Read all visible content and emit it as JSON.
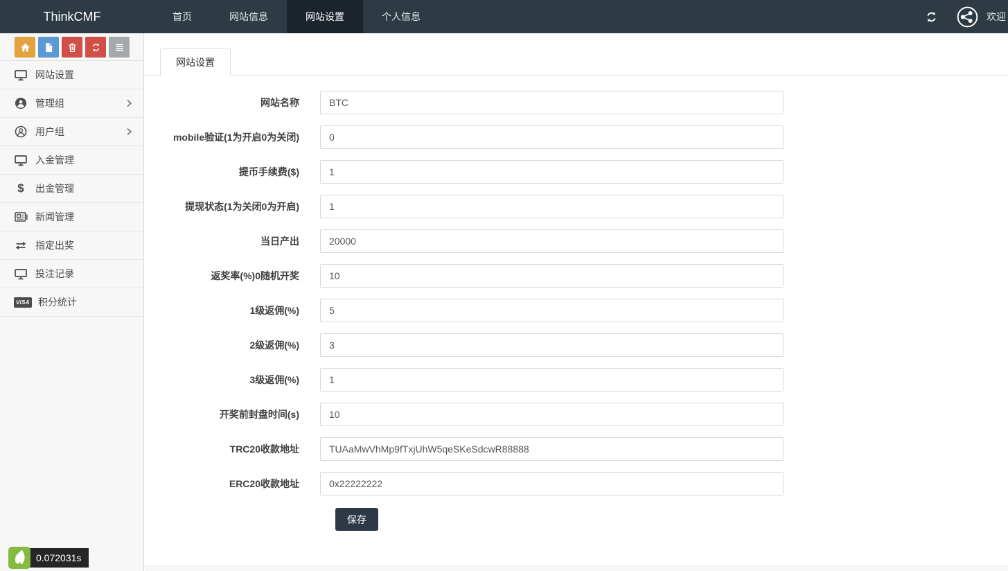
{
  "topbar": {
    "brand": "ThinkCMF",
    "nav": [
      {
        "label": "首页",
        "active": false
      },
      {
        "label": "网站信息",
        "active": false
      },
      {
        "label": "网站设置",
        "active": true
      },
      {
        "label": "个人信息",
        "active": false
      }
    ],
    "icons": {
      "refresh": "refresh-icon",
      "network": "network-share-icon"
    },
    "welcome_text": "欢迎",
    "bg_color": "#2e3a44",
    "active_bg_color": "#1b242c"
  },
  "sidebar": {
    "toolbar": [
      {
        "icon": "home-icon",
        "color": "#e2a33e"
      },
      {
        "icon": "file-icon",
        "color": "#5b9bd5"
      },
      {
        "icon": "trash-icon",
        "color": "#d05048"
      },
      {
        "icon": "recycle-icon",
        "color": "#d05048"
      },
      {
        "icon": "list-icon",
        "color": "#a3a9ad"
      }
    ],
    "menu": [
      {
        "label": "网站设置",
        "icon": "monitor-icon",
        "has_children": false
      },
      {
        "label": "管理组",
        "icon": "user-filled-icon",
        "has_children": true
      },
      {
        "label": "用户组",
        "icon": "user-outline-icon",
        "has_children": true
      },
      {
        "label": "入金管理",
        "icon": "monitor-icon",
        "has_children": false
      },
      {
        "label": "出金管理",
        "icon": "dollar-icon",
        "has_children": false
      },
      {
        "label": "新闻管理",
        "icon": "newspaper-icon",
        "has_children": false
      },
      {
        "label": "指定出奖",
        "icon": "exchange-arrows-icon",
        "has_children": false
      },
      {
        "label": "投注记录",
        "icon": "monitor-icon",
        "has_children": false
      },
      {
        "label": "积分统计",
        "icon": "visa-icon",
        "has_children": false
      }
    ],
    "visa_icon_text": "VISA",
    "footer": {
      "exec_time": "0.072031s",
      "logo_color": "#84ba3f",
      "badge_color": "#262626"
    }
  },
  "main": {
    "tab_label": "网站设置",
    "form": {
      "rows": [
        {
          "label": "网站名称",
          "value": "BTC"
        },
        {
          "label": "mobile验证(1为开启0为关闭)",
          "value": "0"
        },
        {
          "label": "提币手续费($)",
          "value": "1"
        },
        {
          "label": "提现状态(1为关闭0为开启)",
          "value": "1"
        },
        {
          "label": "当日产出",
          "value": "20000"
        },
        {
          "label": "返奖率(%)0随机开奖",
          "value": "10"
        },
        {
          "label": "1级返佣(%)",
          "value": "5"
        },
        {
          "label": "2级返佣(%)",
          "value": "3"
        },
        {
          "label": "3级返佣(%)",
          "value": "1"
        },
        {
          "label": "开奖前封盘时间(s)",
          "value": "10"
        },
        {
          "label": "TRC20收款地址",
          "value": "TUAaMwVhMp9fTxjUhW5qeSKeSdcwR88888"
        },
        {
          "label": "ERC20收款地址",
          "value": "0x22222222"
        }
      ],
      "save_label": "保存",
      "save_color": "#2d3a46"
    }
  }
}
